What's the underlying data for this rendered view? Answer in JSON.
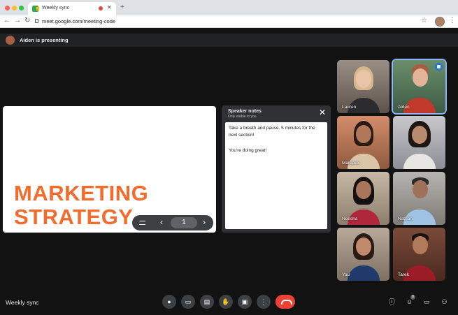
{
  "browser": {
    "tab_title": "Weekly sync",
    "url": "meet.google.com/meeting-code"
  },
  "presenting_label": "Aiden is presenting",
  "slide": {
    "line1": "MARKETING",
    "line2": "STRATEGY",
    "page": "1"
  },
  "notes": {
    "title": "Speaker notes",
    "subtitle": "Only visible to you",
    "line1": "Take a breath and pause. 5 minutes for the next section!",
    "line2": "You're doing great!"
  },
  "participants": [
    {
      "name": "Lauren"
    },
    {
      "name": "Aiden",
      "speaking": true
    },
    {
      "name": "Margaux"
    },
    {
      "name": ""
    },
    {
      "name": "Neesha"
    },
    {
      "name": "Nathan"
    },
    {
      "name": "You"
    },
    {
      "name": "Tarek"
    }
  ],
  "meeting_title": "Weekly sync",
  "people_count": "8",
  "colors": {
    "accent": "#8ab4f8",
    "end_call": "#ea4335",
    "slide_text": "#f26c2e"
  }
}
